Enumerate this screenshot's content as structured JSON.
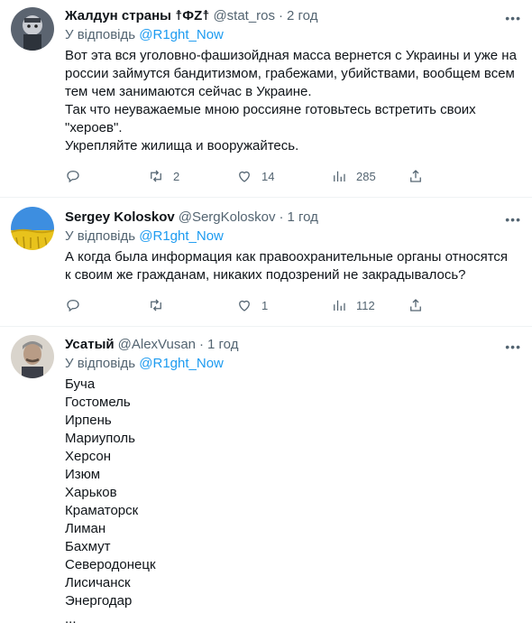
{
  "tweets": [
    {
      "name": "Жалдун страны ☨ФZ☨",
      "handle": "@stat_ros",
      "time": "2 год",
      "replying_prefix": "У відповідь",
      "replying_to": "@R1ght_Now",
      "lines": [
        "Вот эта вся уголовно-фашизойдная масса вернется с Украины и уже на",
        "россии займутся бандитизмом, грабежами, убийствами, вообщем всем",
        "тем чем занимаются сейчас в Украине.",
        "Так что неуважаемые мною россияне готовьтесь встретить своих",
        "\"хероев\".",
        "Укрепляйте жилища и вооружайтесь."
      ],
      "replies": "",
      "retweets": "2",
      "likes": "14",
      "views": "285"
    },
    {
      "name": "Sergey Koloskov",
      "handle": "@SergKoloskov",
      "time": "1 год",
      "replying_prefix": "У відповідь",
      "replying_to": "@R1ght_Now",
      "lines": [
        "А когда была информация как правоохранительные органы относятся",
        "к своим же гражданам, никаких подозрений не закрадывалось?"
      ],
      "replies": "",
      "retweets": "",
      "likes": "1",
      "views": "112"
    },
    {
      "name": "Усатый",
      "handle": "@AlexVusan",
      "time": "1 год",
      "replying_prefix": "У відповідь",
      "replying_to": "@R1ght_Now",
      "lines": [
        "Буча",
        "Гостомель",
        "Ирпень",
        "Мариуполь",
        "Херсон",
        "Изюм",
        "Харьков",
        "Краматорск",
        "Лиман",
        "Бахмут",
        "Северодонецк",
        "Лисичанск",
        "Энергодар",
        "..."
      ]
    }
  ],
  "more_icon": "more-dots-icon",
  "colors": {
    "link": "#1d9bf0",
    "secondary": "#536471",
    "text": "#0f1419"
  }
}
